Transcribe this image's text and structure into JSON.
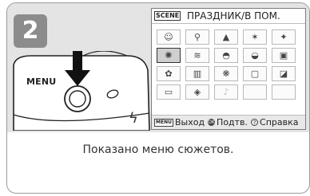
{
  "step": {
    "number": "2"
  },
  "camera": {
    "menu_button_label": "MENU"
  },
  "lcd": {
    "scene_tag": "SCENE",
    "title": "ПРАЗДНИК/В ПОМ.",
    "grid": [
      {
        "icon": "portrait-icon",
        "glyph": "☺"
      },
      {
        "icon": "landscape-person-icon",
        "glyph": "⚲"
      },
      {
        "icon": "landscape-icon",
        "glyph": "▲"
      },
      {
        "icon": "sports-icon",
        "glyph": "✶"
      },
      {
        "icon": "night-portrait-icon",
        "glyph": "✦"
      },
      {
        "icon": "party-indoor-icon",
        "glyph": "✺"
      },
      {
        "icon": "beach-snow-icon",
        "glyph": "≋"
      },
      {
        "icon": "sunset-icon",
        "glyph": "◓"
      },
      {
        "icon": "dusk-dawn-icon",
        "glyph": "◒"
      },
      {
        "icon": "night-landscape-icon",
        "glyph": "▣"
      },
      {
        "icon": "close-up-icon",
        "glyph": "✿"
      },
      {
        "icon": "museum-icon",
        "glyph": "▥"
      },
      {
        "icon": "fireworks-icon",
        "glyph": "❋"
      },
      {
        "icon": "copy-icon",
        "glyph": "▢"
      },
      {
        "icon": "backlight-icon",
        "glyph": "◪"
      },
      {
        "icon": "panorama-icon",
        "glyph": "▭"
      },
      {
        "icon": "sports-spectator-icon",
        "glyph": "◈"
      },
      {
        "icon": "voice-recording-icon",
        "glyph": "♪"
      },
      {
        "icon": "empty-slot",
        "glyph": ""
      },
      {
        "icon": "empty-slot",
        "glyph": ""
      }
    ],
    "selected_index": 5,
    "footer": {
      "menu_key": "MENU",
      "exit_label": "Выход",
      "ok_key": "OK",
      "confirm_label": "Подтв.",
      "help_key": "?",
      "help_label": "Справка"
    }
  },
  "caption": "Показано меню сюжетов."
}
